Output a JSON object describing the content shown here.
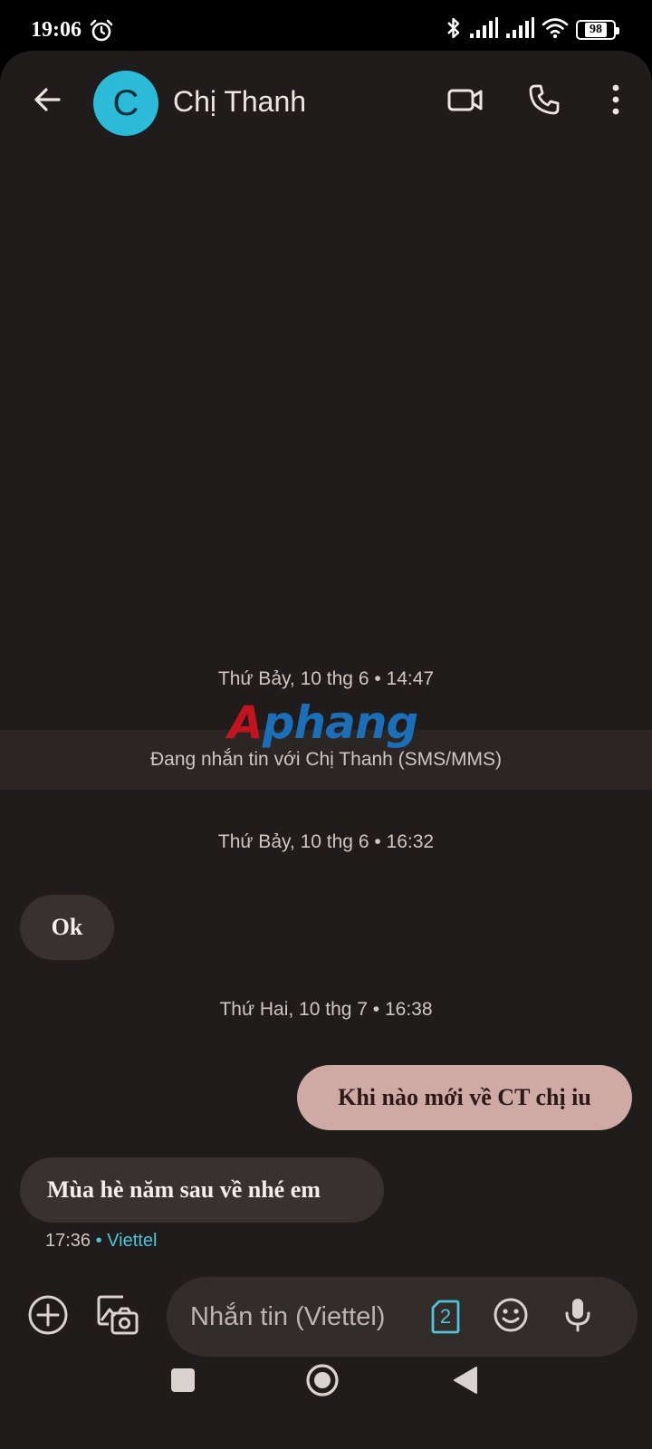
{
  "status_bar": {
    "time": "19:06",
    "battery": "98",
    "icons": [
      "alarm-icon",
      "bluetooth-icon",
      "signal-icon",
      "signal-icon",
      "wifi-icon",
      "battery-icon"
    ]
  },
  "header": {
    "avatar_letter": "C",
    "contact_name": "Chị Thanh",
    "avatar_color": "#2bbbd8"
  },
  "conversation": {
    "stamp1": "Thứ Bảy, 10 thg 6 • 14:47",
    "sms_banner": "Đang nhắn tin với Chị Thanh (SMS/MMS)",
    "stamp2": "Thứ Bảy, 10 thg 6 • 16:32",
    "msg1": "Ok",
    "stamp3": "Thứ Hai, 10 thg 7 • 16:38",
    "msg2": "Khi nào mới về CT chị iu",
    "msg3": "Mùa hè năm sau về nhé em",
    "msg3_time": "17:36",
    "msg3_carrier": "• Viettel"
  },
  "watermark": {
    "part1": "A",
    "part2": "phang"
  },
  "composer": {
    "placeholder": "Nhắn tin (Viettel)",
    "sim_number": "2"
  },
  "colors": {
    "background": "#201c1b",
    "incoming_bubble": "#373130",
    "outgoing_bubble": "#cfa9a3",
    "accent": "#4fc3d9"
  }
}
